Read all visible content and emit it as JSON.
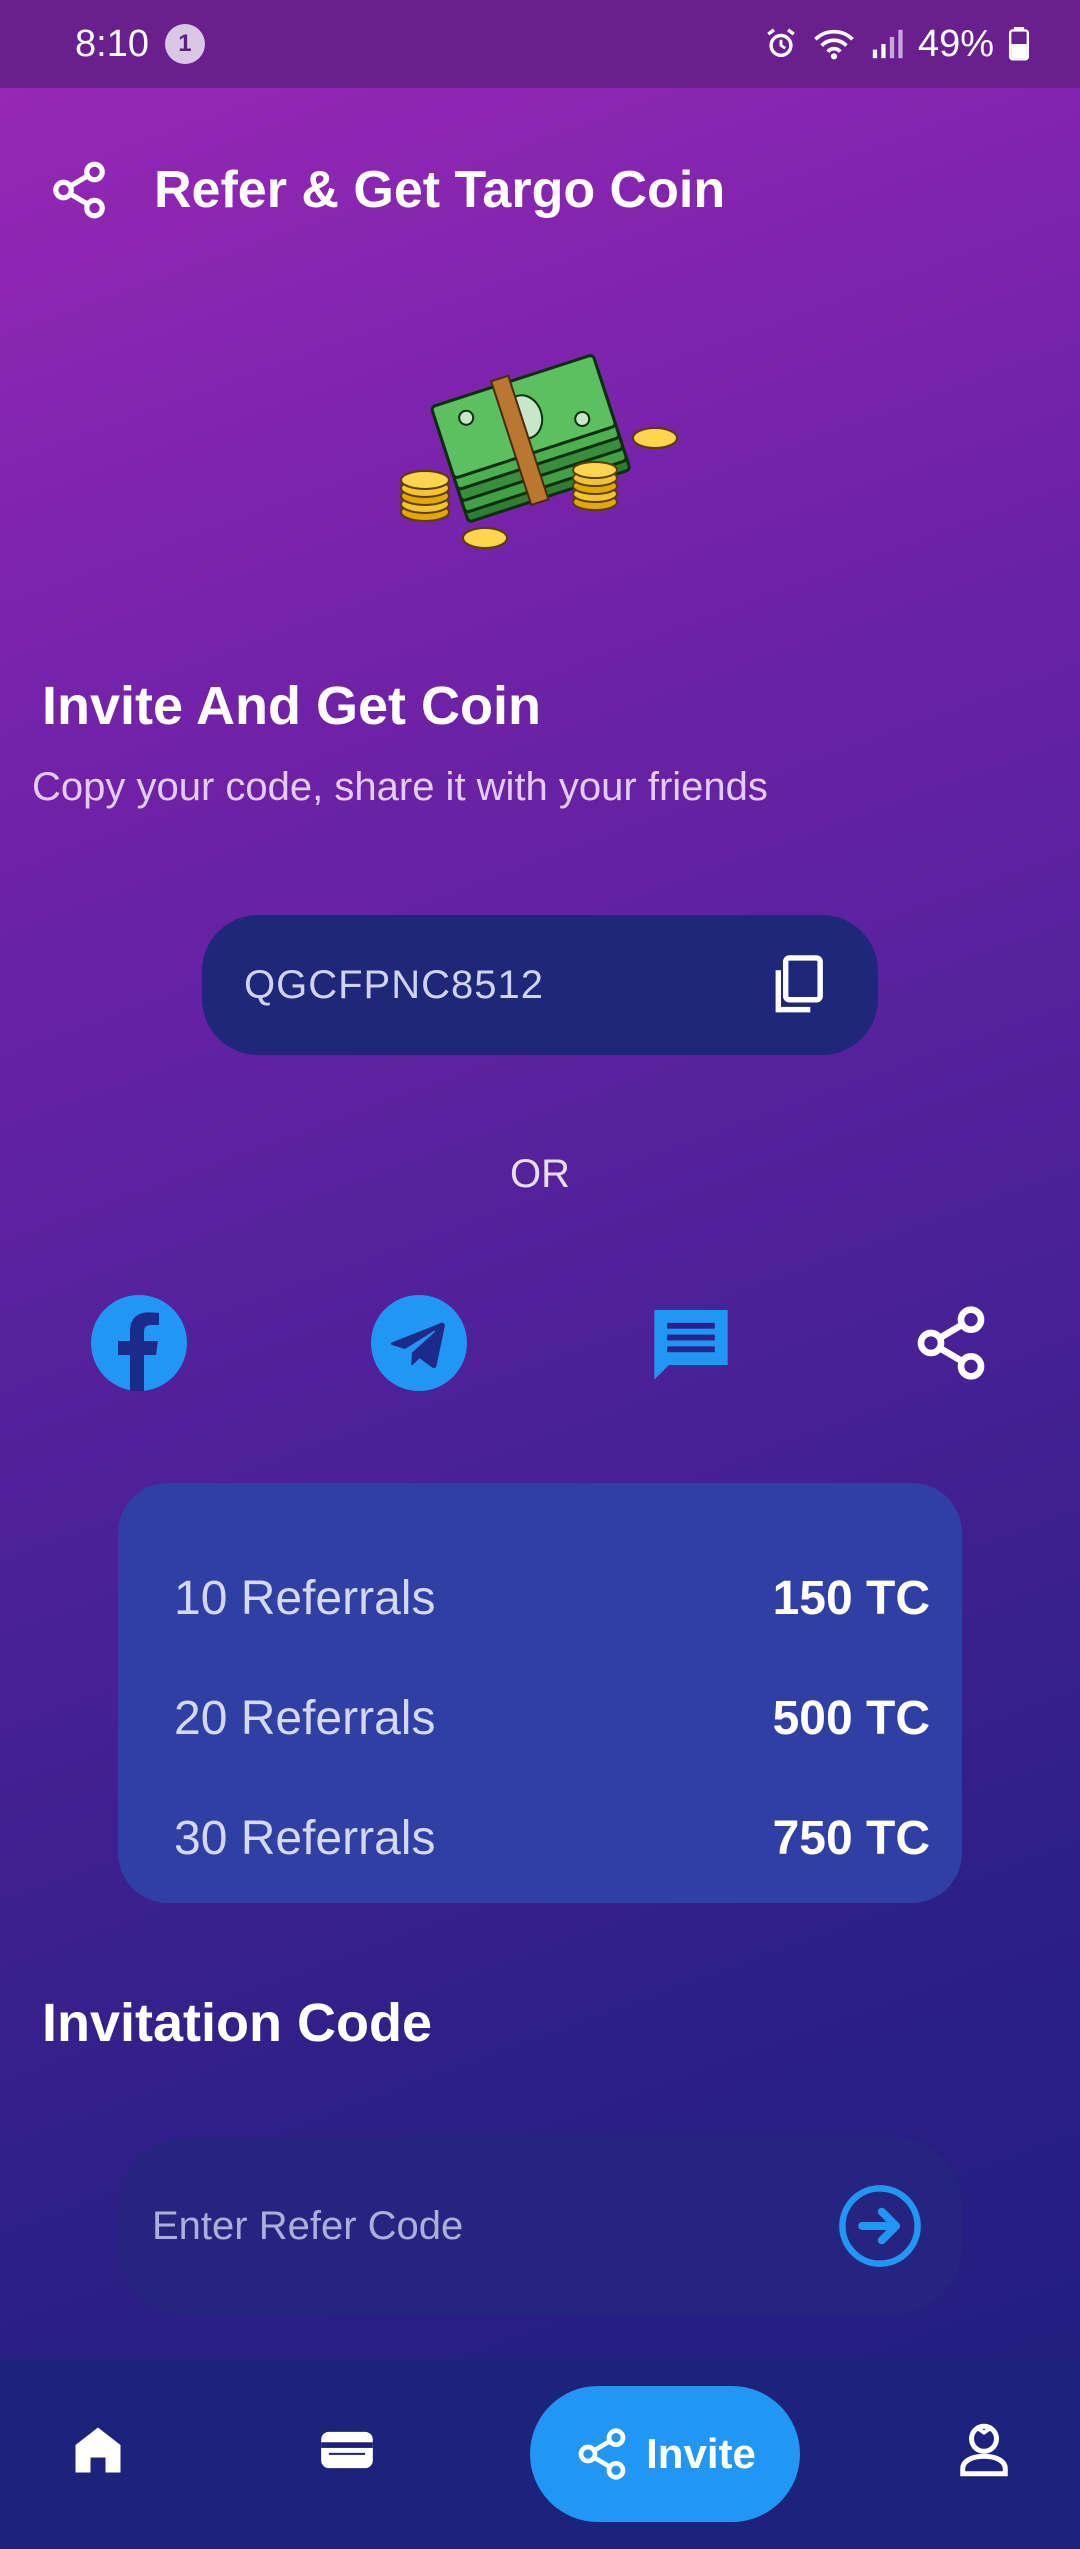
{
  "status_bar": {
    "time": "8:10",
    "notification_count": "1",
    "battery": "49%"
  },
  "header": {
    "title": "Refer & Get Targo Coin",
    "icon": "share-icon"
  },
  "invite": {
    "title": "Invite And Get Coin",
    "subtitle": "Copy your code, share it with your friends",
    "code": "QGCFPNC8512",
    "or_label": "OR"
  },
  "social": [
    {
      "name": "facebook",
      "icon": "facebook-icon",
      "color": "#2196f3"
    },
    {
      "name": "telegram",
      "icon": "telegram-icon",
      "color": "#2196f3"
    },
    {
      "name": "message",
      "icon": "message-icon",
      "color": "#2196f3"
    },
    {
      "name": "share",
      "icon": "share-icon",
      "color": "#ffffff"
    }
  ],
  "rewards": [
    {
      "label": "10 Referrals",
      "value": "150 TC"
    },
    {
      "label": "20 Referrals",
      "value": "500 TC"
    },
    {
      "label": "30 Referrals",
      "value": "750 TC"
    }
  ],
  "invitation": {
    "title": "Invitation Code",
    "placeholder": "Enter Refer Code"
  },
  "bottom_nav": {
    "items": [
      {
        "name": "home",
        "icon": "home-icon"
      },
      {
        "name": "wallet",
        "icon": "wallet-icon"
      },
      {
        "name": "invite",
        "icon": "share-icon",
        "label": "Invite",
        "active": true
      },
      {
        "name": "profile",
        "icon": "profile-icon"
      }
    ]
  },
  "colors": {
    "accent": "#2196f3",
    "code_box": "#1e2779",
    "rewards_card": "#2f3fa3",
    "nav_bar": "#1d237a"
  }
}
